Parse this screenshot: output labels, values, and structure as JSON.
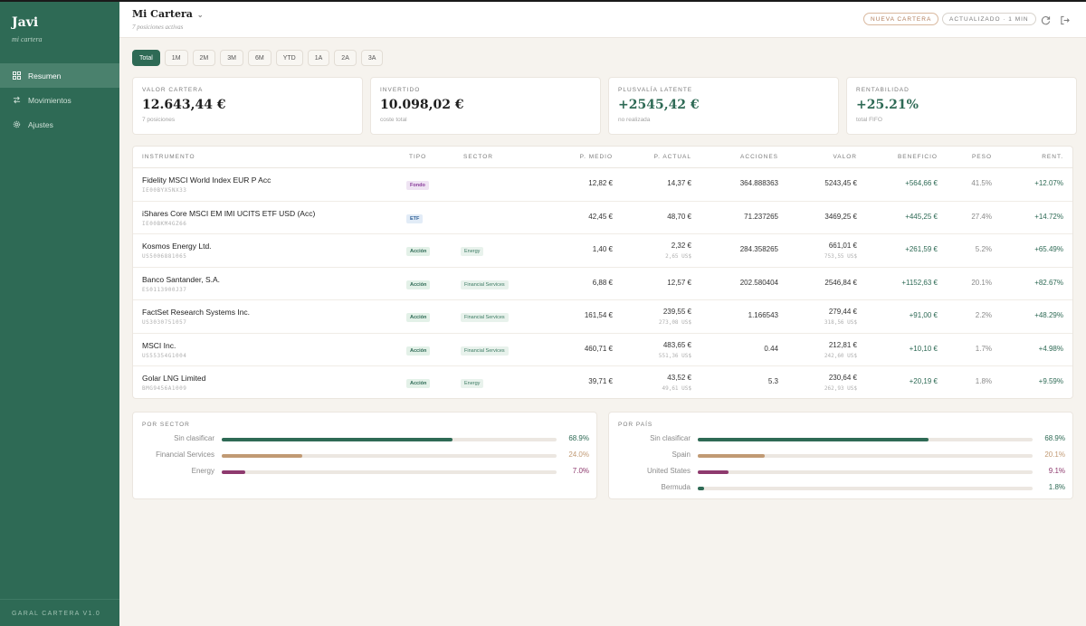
{
  "sidebar": {
    "user_name": "Javi",
    "user_sub": "mi cartera",
    "items": [
      {
        "label": "Resumen",
        "icon": "grid-icon",
        "active": true
      },
      {
        "label": "Movimientos",
        "icon": "swap-icon",
        "active": false
      },
      {
        "label": "Ajustes",
        "icon": "gear-icon",
        "active": false
      }
    ],
    "footer": "GARAL CARTERA V1.0"
  },
  "header": {
    "title": "Mi Cartera",
    "subtitle": "7 posiciones activas",
    "new_button": "NUEVA CARTERA",
    "updated": "ACTUALIZADO · 1 MIN"
  },
  "periods": [
    "Total",
    "1M",
    "2M",
    "3M",
    "6M",
    "YTD",
    "1A",
    "2A",
    "3A"
  ],
  "active_period": "Total",
  "kpis": [
    {
      "label": "VALOR CARTERA",
      "value": "12.643,44 €",
      "note": "7 posiciones"
    },
    {
      "label": "INVERTIDO",
      "value": "10.098,02 €",
      "note": "coste total"
    },
    {
      "label": "PLUSVALÍA LATENTE",
      "value": "+2545,42 €",
      "note": "no realizada"
    },
    {
      "label": "RENTABILIDAD",
      "value": "+25.21%",
      "note": "total FIFO"
    }
  ],
  "table": {
    "headers": {
      "instrumento": "INSTRUMENTO",
      "tipo": "TIPO",
      "sector": "SECTOR",
      "p_medio": "P. MEDIO",
      "p_actual": "P. ACTUAL",
      "acciones": "ACCIONES",
      "valor": "VALOR",
      "beneficio": "BENEFICIO",
      "peso": "PESO",
      "rent": "RENT."
    },
    "rows": [
      {
        "name": "Fidelity MSCI World Index EUR P Acc",
        "isin": "IE00BYX5NX33",
        "tipo": "Fondo",
        "sector": "",
        "p_medio": "12,82 €",
        "p_actual": "14,37 €",
        "p_actual_usd": "",
        "acciones": "364.888363",
        "valor": "5243,45 €",
        "valor_usd": "",
        "beneficio": "+564,66 €",
        "peso": "41.5%",
        "rent": "+12.07%"
      },
      {
        "name": "iShares Core MSCI EM IMI UCITS ETF USD (Acc)",
        "isin": "IE00BKM4GZ66",
        "tipo": "ETF",
        "sector": "",
        "p_medio": "42,45 €",
        "p_actual": "48,70 €",
        "p_actual_usd": "",
        "acciones": "71.237265",
        "valor": "3469,25 €",
        "valor_usd": "",
        "beneficio": "+445,25 €",
        "peso": "27.4%",
        "rent": "+14.72%"
      },
      {
        "name": "Kosmos Energy Ltd.",
        "isin": "US5006881065",
        "tipo": "Acción",
        "sector": "Energy",
        "p_medio": "1,40 €",
        "p_actual": "2,32 €",
        "p_actual_usd": "2,65 US$",
        "acciones": "284.358265",
        "valor": "661,01 €",
        "valor_usd": "753,55 US$",
        "beneficio": "+261,59 €",
        "peso": "5.2%",
        "rent": "+65.49%"
      },
      {
        "name": "Banco Santander, S.A.",
        "isin": "ES0113900J37",
        "tipo": "Acción",
        "sector": "Financial Services",
        "p_medio": "6,88 €",
        "p_actual": "12,57 €",
        "p_actual_usd": "",
        "acciones": "202.580404",
        "valor": "2546,84 €",
        "valor_usd": "",
        "beneficio": "+1152,63 €",
        "peso": "20.1%",
        "rent": "+82.67%"
      },
      {
        "name": "FactSet Research Systems Inc.",
        "isin": "US3030751057",
        "tipo": "Acción",
        "sector": "Financial Services",
        "p_medio": "161,54 €",
        "p_actual": "239,55 €",
        "p_actual_usd": "273,08 US$",
        "acciones": "1.166543",
        "valor": "279,44 €",
        "valor_usd": "318,56 US$",
        "beneficio": "+91,00 €",
        "peso": "2.2%",
        "rent": "+48.29%"
      },
      {
        "name": "MSCI Inc.",
        "isin": "US55354G1004",
        "tipo": "Acción",
        "sector": "Financial Services",
        "p_medio": "460,71 €",
        "p_actual": "483,65 €",
        "p_actual_usd": "551,36 US$",
        "acciones": "0.44",
        "valor": "212,81 €",
        "valor_usd": "242,60 US$",
        "beneficio": "+10,10 €",
        "peso": "1.7%",
        "rent": "+4.98%"
      },
      {
        "name": "Golar LNG Limited",
        "isin": "BMG9456A1009",
        "tipo": "Acción",
        "sector": "Energy",
        "p_medio": "39,71 €",
        "p_actual": "43,52 €",
        "p_actual_usd": "49,61 US$",
        "acciones": "5.3",
        "valor": "230,64 €",
        "valor_usd": "262,93 US$",
        "beneficio": "+20,19 €",
        "peso": "1.8%",
        "rent": "+9.59%"
      }
    ]
  },
  "by_sector": {
    "title": "POR SECTOR",
    "items": [
      {
        "label": "Sin clasificar",
        "pct": "68.9%",
        "value": 68.9,
        "color": "#2e6a55"
      },
      {
        "label": "Financial Services",
        "pct": "24.0%",
        "value": 24.0,
        "color": "#c19a74"
      },
      {
        "label": "Energy",
        "pct": "7.0%",
        "value": 7.0,
        "color": "#8e3a6e"
      }
    ]
  },
  "by_country": {
    "title": "POR PAÍS",
    "items": [
      {
        "label": "Sin clasificar",
        "pct": "68.9%",
        "value": 68.9,
        "color": "#2e6a55"
      },
      {
        "label": "Spain",
        "pct": "20.1%",
        "value": 20.1,
        "color": "#c19a74"
      },
      {
        "label": "United States",
        "pct": "9.1%",
        "value": 9.1,
        "color": "#8e3a6e"
      },
      {
        "label": "Bermuda",
        "pct": "1.8%",
        "value": 1.8,
        "color": "#2e6a55"
      }
    ]
  }
}
